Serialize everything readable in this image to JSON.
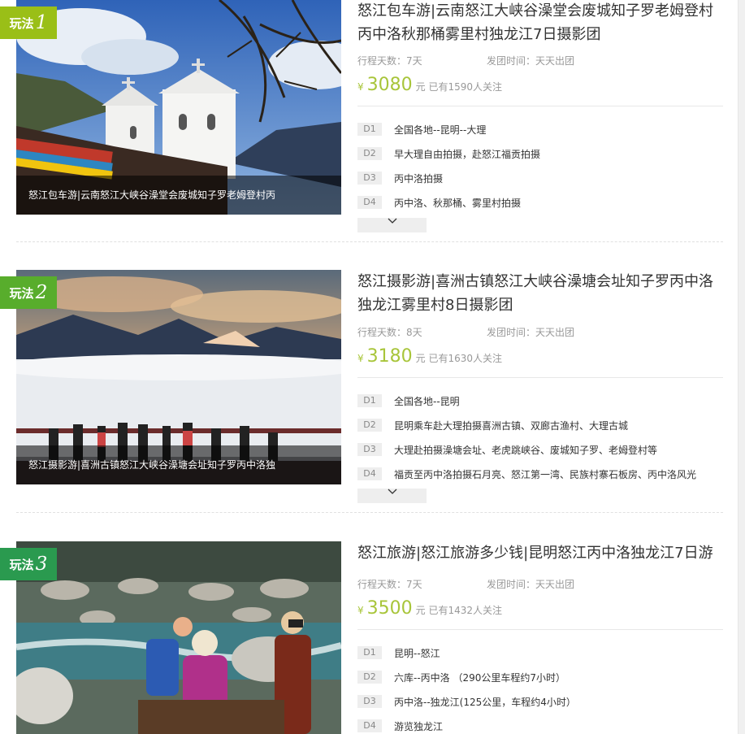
{
  "colors": {
    "badge1": "#9abf17",
    "badge2": "#58ad2c",
    "badge3": "#2a9a4f",
    "price": "#a8c53a"
  },
  "routes": [
    {
      "badge_label": "玩法",
      "badge_num": "1",
      "title": "怒江包车游|云南怒江大峡谷澡堂会废城知子罗老姆登村丙中洛秋那桶雾里村独龙江7日摄影团",
      "caption": "怒江包车游|云南怒江大峡谷澡堂会废城知子罗老姆登村丙",
      "days_label": "行程天数：7天",
      "depart_label": "发团时间：天天出团",
      "currency": "¥",
      "price": "3080",
      "follow_text": "元 已有1590人关注",
      "itinerary": [
        {
          "day": "D1",
          "text": "全国各地--昆明--大理"
        },
        {
          "day": "D2",
          "text": "早大理自由拍摄，赴怒江福贡拍摄"
        },
        {
          "day": "D3",
          "text": "丙中洛拍摄"
        },
        {
          "day": "D4",
          "text": "丙中洛、秋那桶、雾里村拍摄"
        }
      ]
    },
    {
      "badge_label": "玩法",
      "badge_num": "2",
      "title": "怒江摄影游|喜洲古镇怒江大峡谷澡塘会址知子罗丙中洛独龙江雾里村8日摄影团",
      "caption": "怒江摄影游|喜洲古镇怒江大峡谷澡塘会址知子罗丙中洛独",
      "days_label": "行程天数：8天",
      "depart_label": "发团时间：天天出团",
      "currency": "¥",
      "price": "3180",
      "follow_text": "元 已有1630人关注",
      "itinerary": [
        {
          "day": "D1",
          "text": "全国各地--昆明"
        },
        {
          "day": "D2",
          "text": "昆明乘车赴大理拍摄喜洲古镇、双廊古渔村、大理古城"
        },
        {
          "day": "D3",
          "text": "大理赴拍摄澡塘会址、老虎跳峡谷、废城知子罗、老姆登村等"
        },
        {
          "day": "D4",
          "text": "福贡至丙中洛拍摄石月亮、怒江第一湾、民族村寨石板房、丙中洛风光"
        }
      ]
    },
    {
      "badge_label": "玩法",
      "badge_num": "3",
      "title": "怒江旅游|怒江旅游多少钱|昆明怒江丙中洛独龙江7日游",
      "caption": "",
      "days_label": "行程天数：7天",
      "depart_label": "发团时间：天天出团",
      "currency": "¥",
      "price": "3500",
      "follow_text": "元 已有1432人关注",
      "itinerary": [
        {
          "day": "D1",
          "text": "昆明--怒江"
        },
        {
          "day": "D2",
          "text": "六库--丙中洛 （290公里车程约7小时）"
        },
        {
          "day": "D3",
          "text": "丙中洛--独龙江(125公里，车程约4小时）"
        },
        {
          "day": "D4",
          "text": "游览独龙江"
        }
      ]
    }
  ]
}
